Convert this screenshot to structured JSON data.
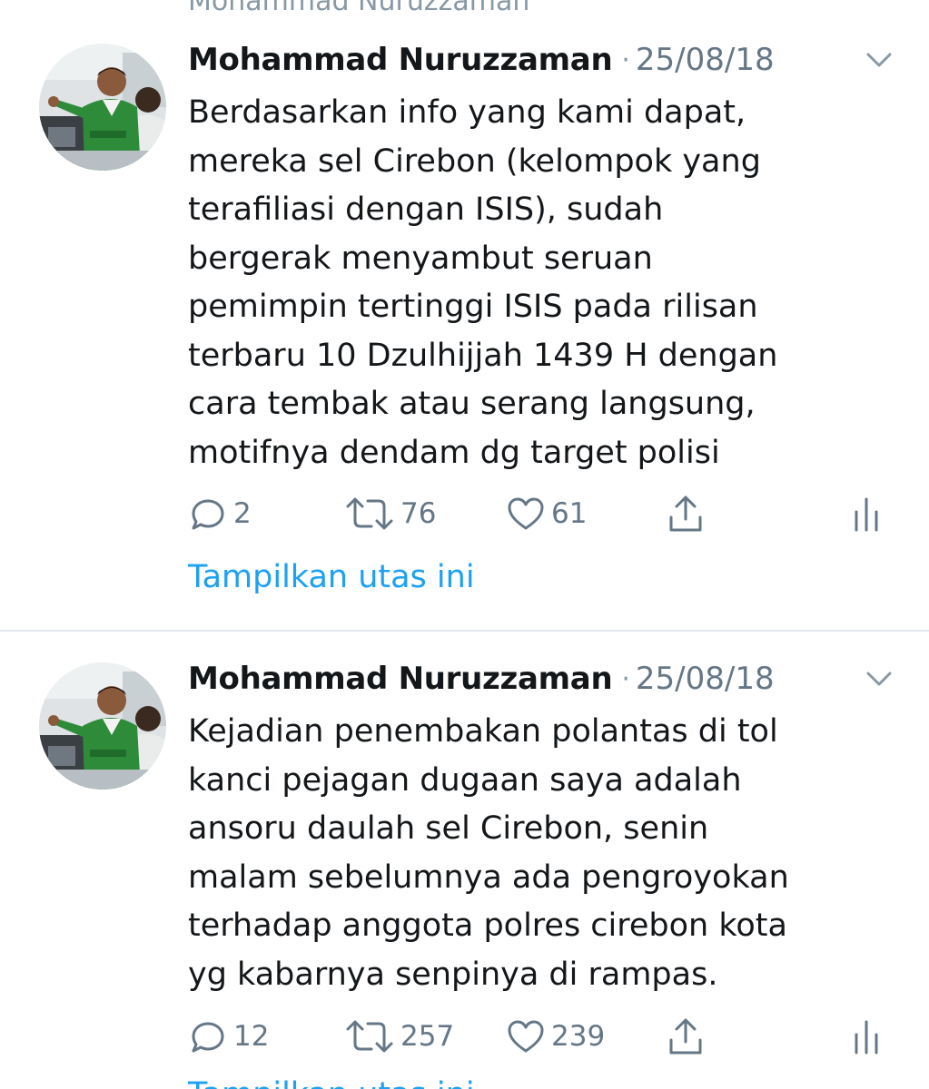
{
  "header_peek": {
    "author": "Mohammad Nuruzzaman"
  },
  "tweets": [
    {
      "author": "Mohammad Nuruzzaman",
      "separator": "·",
      "date": "25/08/18",
      "lines": [
        "Berdasarkan info yang kami dapat,",
        "mereka sel Cirebon (kelompok yang",
        "terafiliasi dengan ISIS), sudah",
        "bergerak menyambut seruan",
        "pemimpin tertinggi ISIS pada rilisan",
        "terbaru 10 Dzulhijjah 1439 H dengan",
        "cara tembak atau serang langsung,",
        "motifnya dendam dg target polisi"
      ],
      "replies": "2",
      "retweets": "76",
      "likes": "61",
      "show_thread": "Tampilkan utas ini"
    },
    {
      "author": "Mohammad Nuruzzaman",
      "separator": "·",
      "date": "25/08/18",
      "lines": [
        "Kejadian penembakan polantas di tol",
        "kanci pejagan dugaan saya adalah",
        "ansoru daulah sel Cirebon, senin",
        "malam sebelumnya ada pengroyokan",
        "terhadap anggota polres cirebon kota",
        "yg kabarnya senpinya di rampas."
      ],
      "replies": "12",
      "retweets": "257",
      "likes": "239",
      "show_thread": "Tampilkan utas ini"
    }
  ],
  "icons": {
    "reply": "speech-bubble-icon",
    "retweet": "retweet-arrows-icon",
    "like": "heart-icon",
    "share": "share-upload-icon",
    "analytics": "analytics-bars-icon",
    "more": "chevron-down-icon"
  },
  "colors": {
    "link": "#1da1f2",
    "muted": "#657786",
    "icon": "#657786",
    "divider": "#e1e8ed"
  }
}
